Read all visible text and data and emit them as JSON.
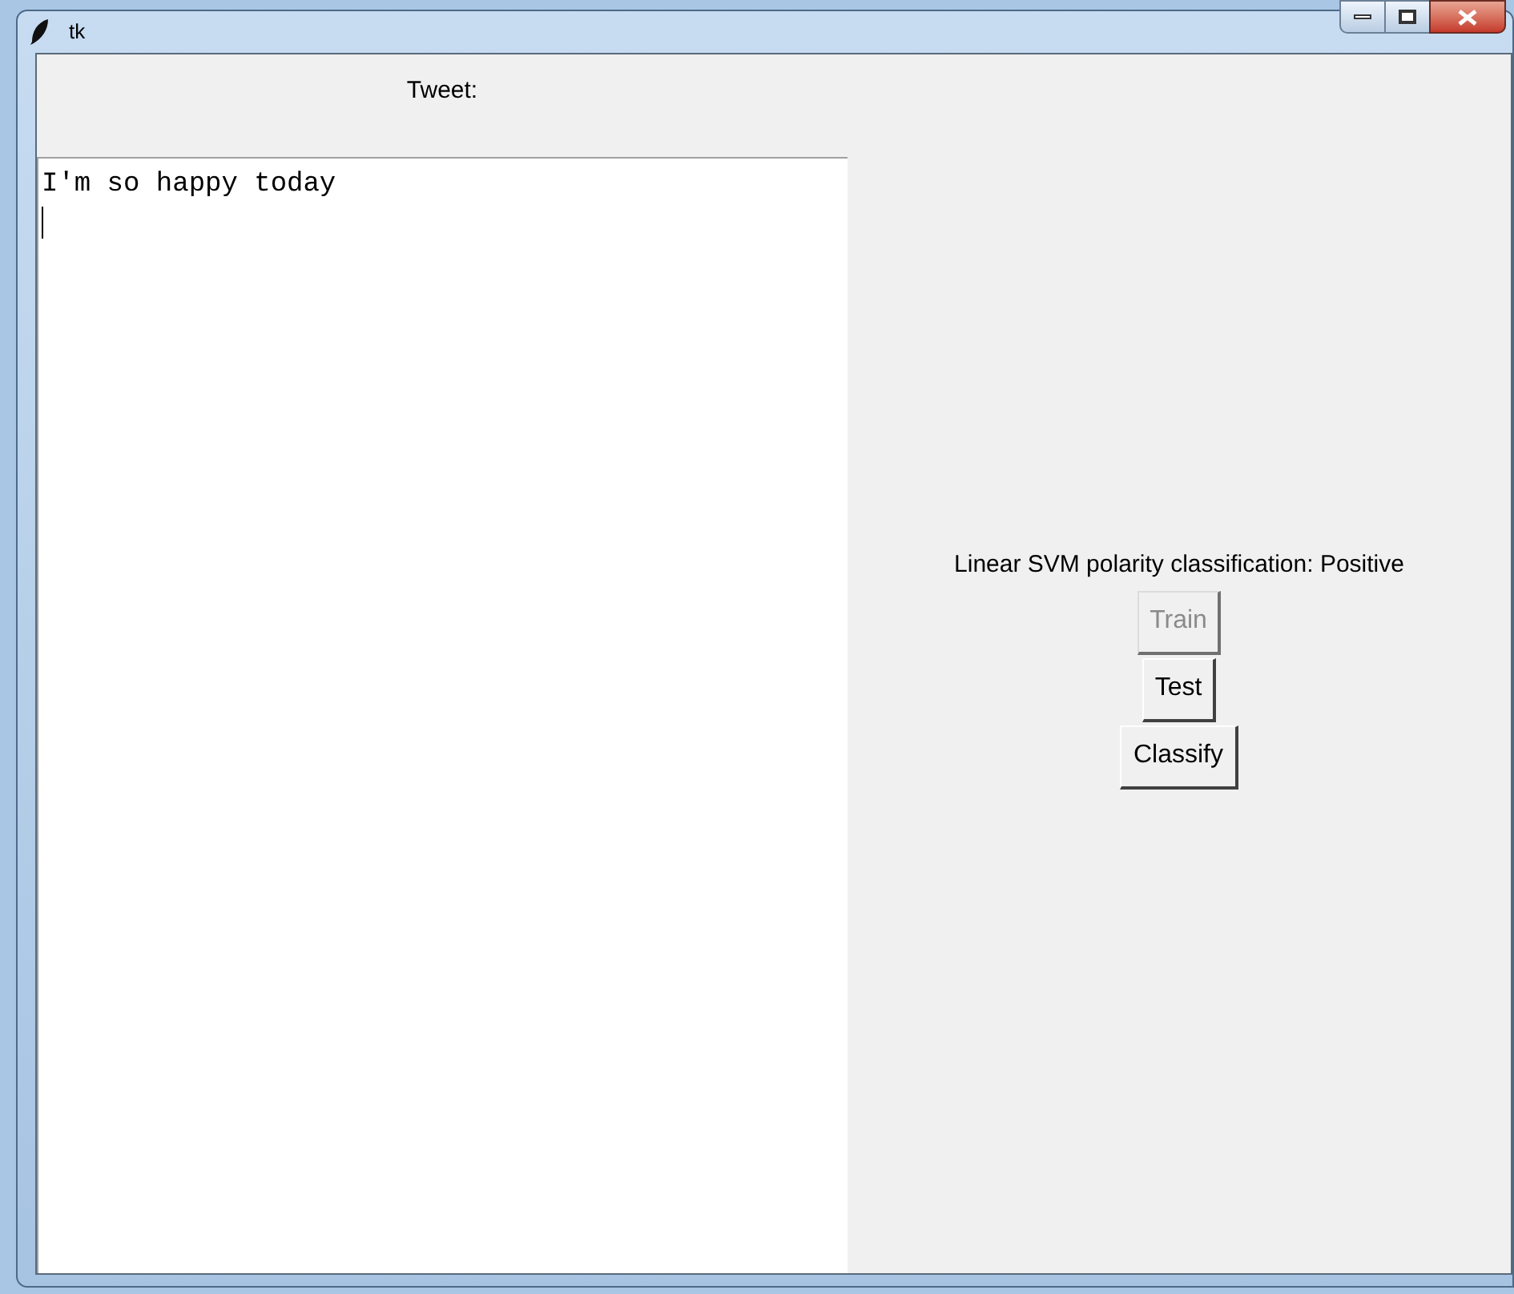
{
  "window": {
    "title": "tk"
  },
  "tweet": {
    "label": "Tweet:",
    "value": "I'm so happy today"
  },
  "result": {
    "label": "Linear SVM polarity classification: Positive"
  },
  "buttons": [
    {
      "label": "Train",
      "disabled": true
    },
    {
      "label": "Test",
      "disabled": false
    },
    {
      "label": "Classify",
      "disabled": false
    }
  ]
}
